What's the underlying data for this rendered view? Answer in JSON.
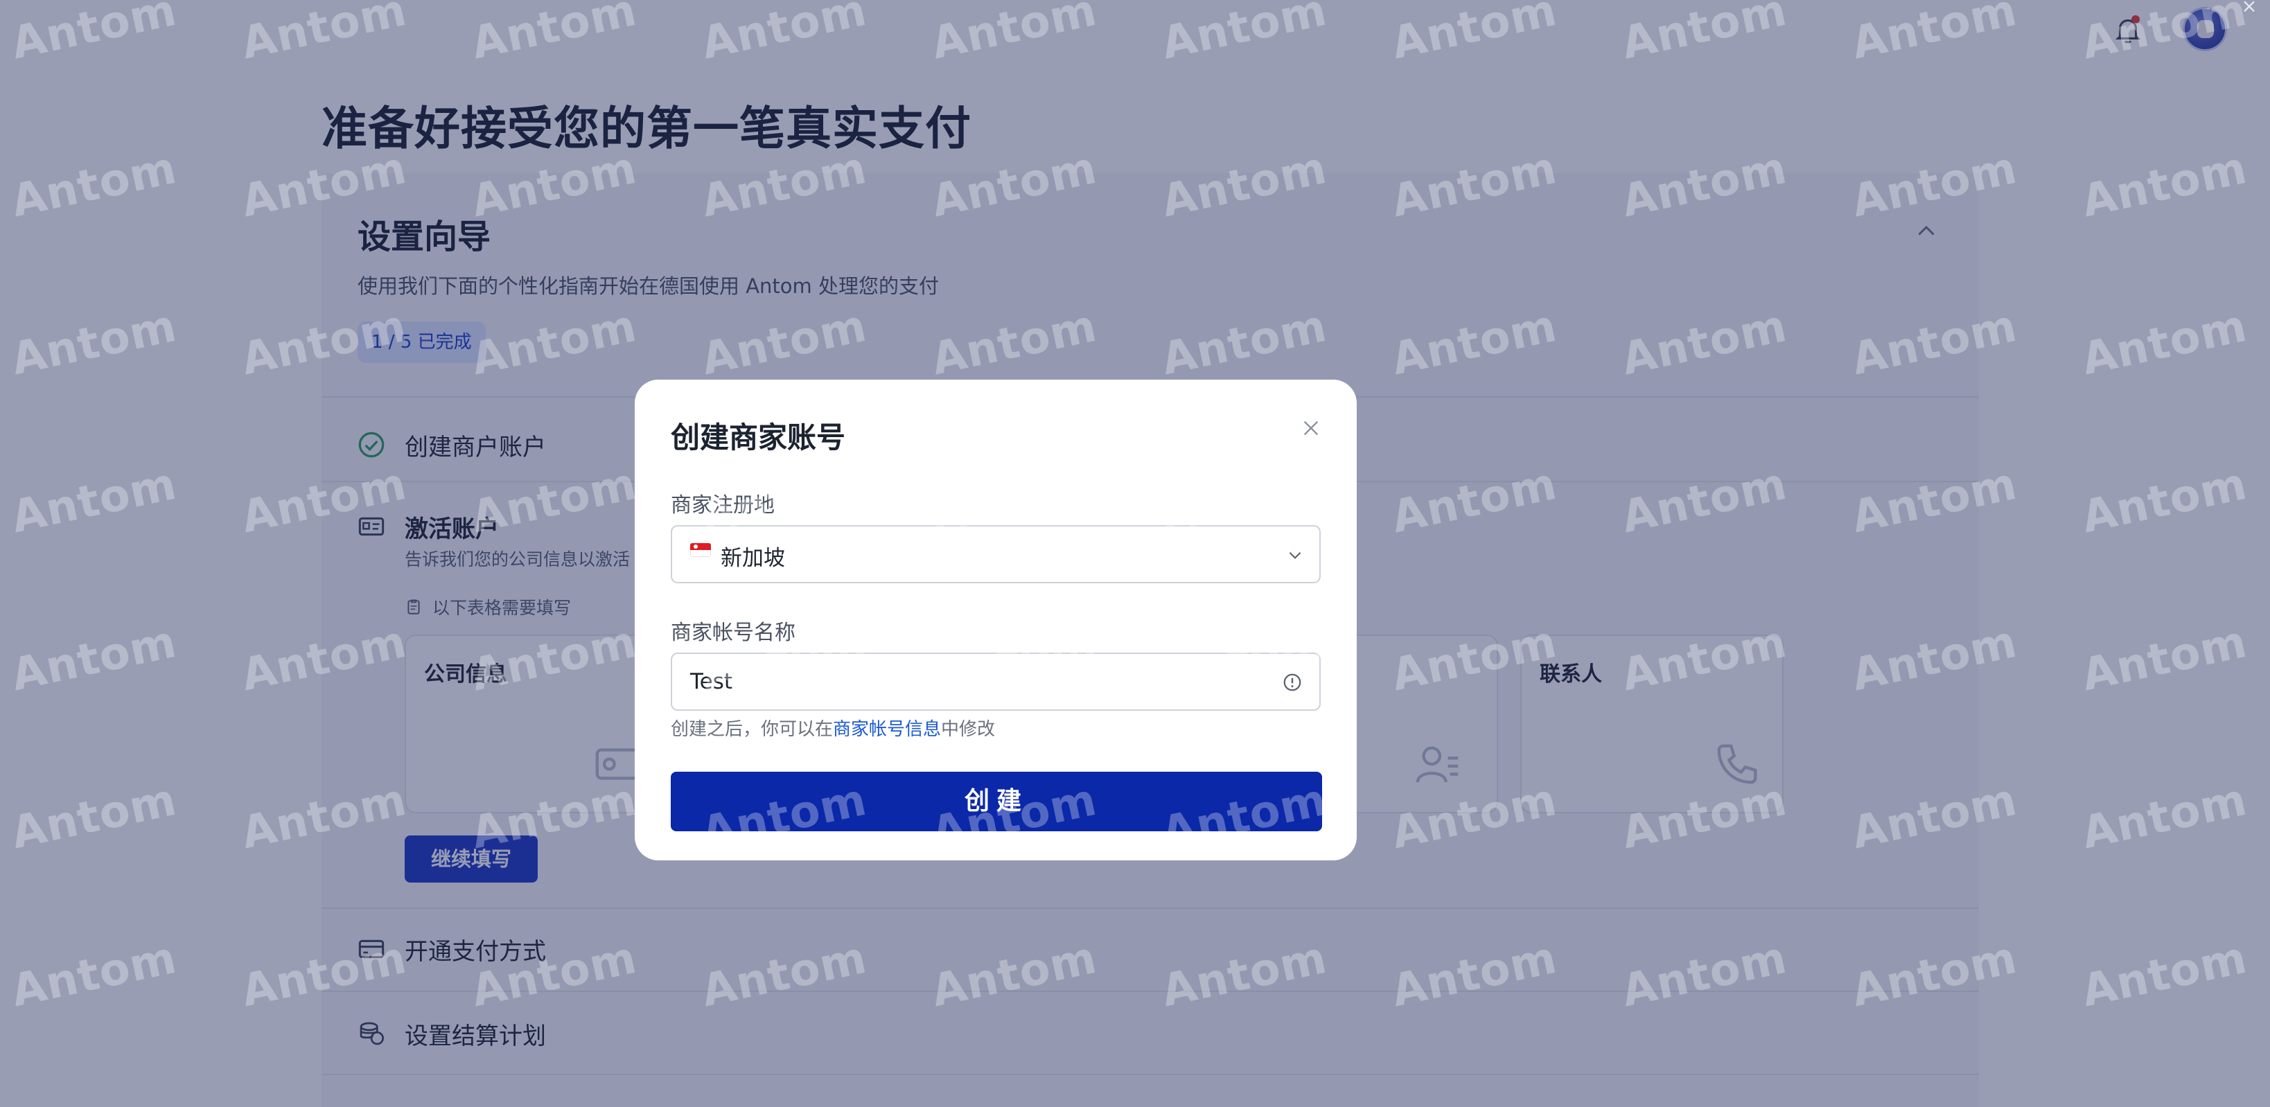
{
  "page": {
    "title": "准备好接受您的第一笔真实支付"
  },
  "guide": {
    "title": "设置向导",
    "description": "使用我们下面的个性化指南开始在德国使用 Antom 处理您的支付",
    "progress": "1 / 5 已完成",
    "steps": [
      {
        "label": "创建商户账户",
        "icon": "check-circle-icon",
        "completed": true
      },
      {
        "label": "激活账户",
        "icon": "id-card-icon",
        "completed": false
      },
      {
        "label": "开通支付方式",
        "icon": "credit-card-icon",
        "completed": false
      },
      {
        "label": "设置结算计划",
        "icon": "coin-stack-icon",
        "completed": false
      }
    ],
    "activate": {
      "subtitle": "告诉我们您的公司信息以激活",
      "form_note": "以下表格需要填写",
      "tiles": [
        {
          "label": "公司信息",
          "icon": "id-badge-icon"
        },
        {
          "label": "",
          "icon": "person-list-icon"
        },
        {
          "label": "联系人",
          "icon": "phone-icon"
        }
      ],
      "continue_label": "继续填写"
    }
  },
  "modal": {
    "title": "创建商家账号",
    "region_label": "商家注册地",
    "region_value": "新加坡",
    "region_flag": "singapore-flag-icon",
    "name_label": "商家帐号名称",
    "name_value": "Test",
    "hint_prefix": "创建之后，你可以在",
    "hint_link": "商家帐号信息",
    "hint_suffix": "中修改",
    "create_label": "创建"
  },
  "watermark": {
    "text": "Antom"
  },
  "colors": {
    "primary": "#0a28a8",
    "overlay": "#1c2658",
    "link": "#1a5ad6",
    "success": "#2e9e5b",
    "notification_dot": "#e53935"
  }
}
